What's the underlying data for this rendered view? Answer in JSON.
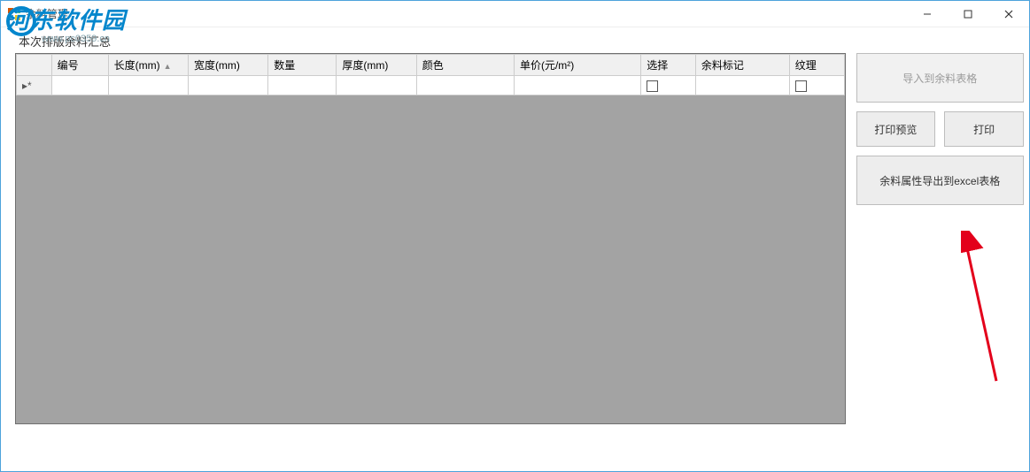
{
  "window": {
    "title": "余料管理"
  },
  "watermark": {
    "main": "河东软件园",
    "sub": "www.pc0359.cn"
  },
  "section": {
    "label": "本次排版余料汇总"
  },
  "grid": {
    "columns": {
      "id": "编号",
      "length": "长度(mm)",
      "width": "宽度(mm)",
      "qty": "数量",
      "thickness": "厚度(mm)",
      "color": "颜色",
      "unitprice": "单价(元/m²)",
      "select": "选择",
      "remmark": "余料标记",
      "texture": "纹理"
    },
    "newrow_marker": "▸*",
    "rows": [
      {
        "id": "",
        "length": "",
        "width": "",
        "qty": "",
        "thickness": "",
        "color": "",
        "unitprice": "",
        "select": false,
        "remmark": "",
        "texture": false
      }
    ]
  },
  "buttons": {
    "import": "导入到余料表格",
    "preview": "打印预览",
    "print": "打印",
    "export": "余料属性导出到excel表格"
  }
}
